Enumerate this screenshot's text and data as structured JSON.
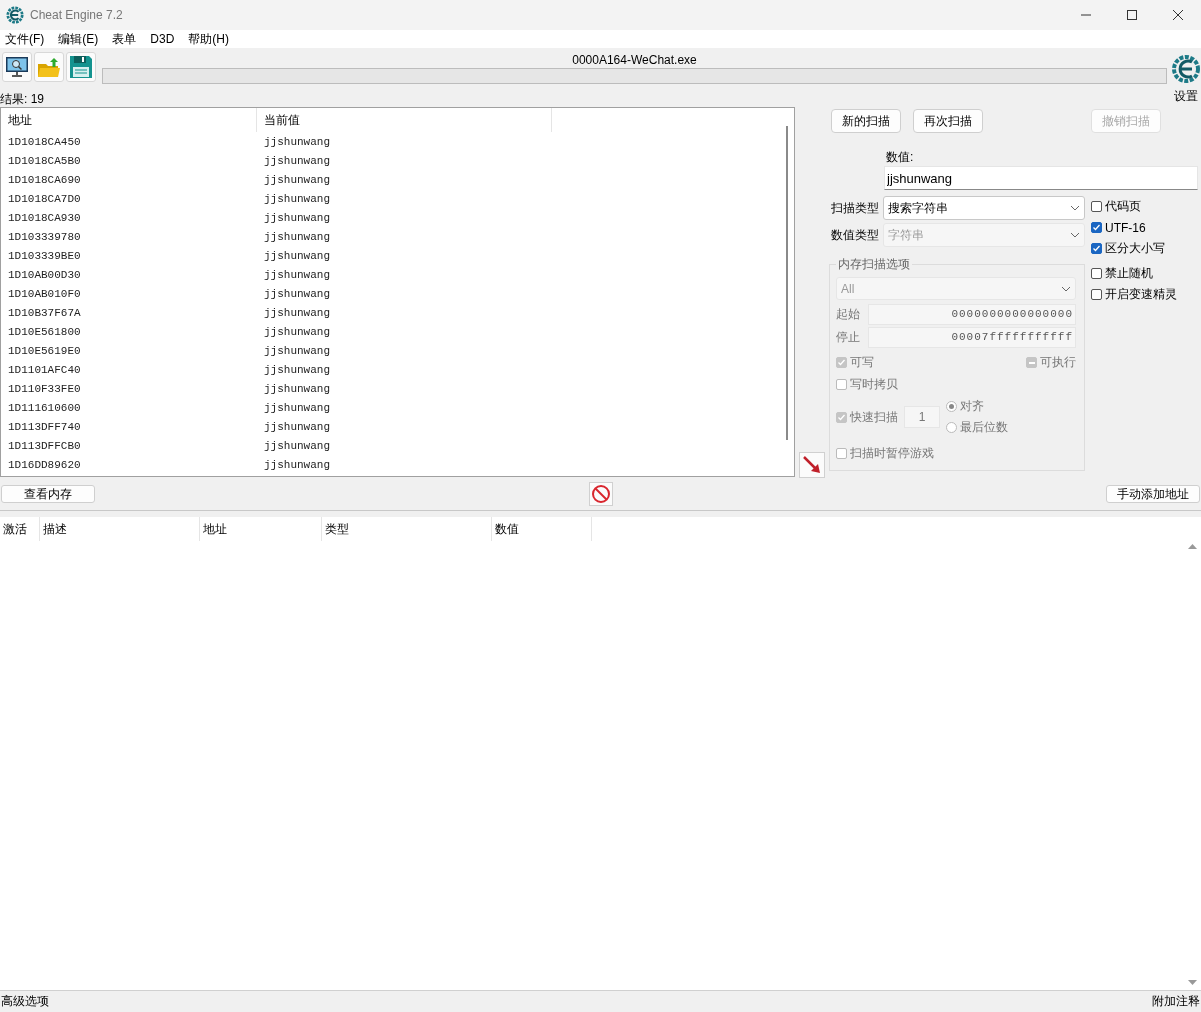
{
  "window": {
    "title": "Cheat Engine 7.2"
  },
  "menu": [
    "文件(F)",
    "编辑(E)",
    "表单",
    "D3D",
    "帮助(H)"
  ],
  "process_title": "0000A164-WeChat.exe",
  "progress": {
    "level": 0
  },
  "settings_label": "设置",
  "results_count": "结果: 19",
  "results": {
    "columns": [
      "地址",
      "当前值"
    ],
    "rows": [
      {
        "address": "1D1018CA450",
        "value": "jjshunwang"
      },
      {
        "address": "1D1018CA5B0",
        "value": "jjshunwang"
      },
      {
        "address": "1D1018CA690",
        "value": "jjshunwang"
      },
      {
        "address": "1D1018CA7D0",
        "value": "jjshunwang"
      },
      {
        "address": "1D1018CA930",
        "value": "jjshunwang"
      },
      {
        "address": "1D103339780",
        "value": "jjshunwang"
      },
      {
        "address": "1D103339BE0",
        "value": "jjshunwang"
      },
      {
        "address": "1D10AB00D30",
        "value": "jjshunwang"
      },
      {
        "address": "1D10AB010F0",
        "value": "jjshunwang"
      },
      {
        "address": "1D10B37F67A",
        "value": "jjshunwang"
      },
      {
        "address": "1D10E561800",
        "value": "jjshunwang"
      },
      {
        "address": "1D10E5619E0",
        "value": "jjshunwang"
      },
      {
        "address": "1D1101AFC40",
        "value": "jjshunwang"
      },
      {
        "address": "1D110F33FE0",
        "value": "jjshunwang"
      },
      {
        "address": "1D111610600",
        "value": "jjshunwang"
      },
      {
        "address": "1D113DFF740",
        "value": "jjshunwang"
      },
      {
        "address": "1D113DFFCB0",
        "value": "jjshunwang"
      },
      {
        "address": "1D16DD89620",
        "value": "jjshunwang"
      }
    ]
  },
  "scan_buttons": [
    {
      "label": "新的扫描",
      "disabled": false
    },
    {
      "label": "再次扫描",
      "disabled": false
    },
    {
      "label": "撤销扫描",
      "disabled": true
    }
  ],
  "value": {
    "label": "数值:",
    "value": "jjshunwang"
  },
  "scan_type": {
    "label": "扫描类型",
    "value": "搜索字符串",
    "disabled": false
  },
  "value_type": {
    "label": "数值类型",
    "value": "字符串",
    "disabled": true
  },
  "string_options": [
    {
      "label": "代码页",
      "checked": false
    },
    {
      "label": "UTF-16",
      "checked": true
    },
    {
      "label": "区分大小写",
      "checked": true
    }
  ],
  "extra_options": [
    {
      "label": "禁止随机",
      "checked": false
    },
    {
      "label": "开启变速精灵",
      "checked": false
    }
  ],
  "memory_options": {
    "title": "内存扫描选项",
    "disabled": true,
    "region": "All",
    "start": {
      "label": "起始",
      "value": "0000000000000000"
    },
    "stop": {
      "label": "停止",
      "value": "00007fffffffffff"
    },
    "writable": {
      "label": "可写",
      "checked": true
    },
    "executable": {
      "label": "可执行",
      "indeterminate": true
    },
    "copy_on_write": {
      "label": "写时拷贝",
      "checked": false
    },
    "fast_scan": {
      "label": "快速扫描",
      "checked": true,
      "value": "1"
    },
    "alignment": [
      {
        "label": "对齐",
        "selected": true
      },
      {
        "label": "最后位数",
        "selected": false
      }
    ],
    "pause_game": {
      "label": "扫描时暂停游戏",
      "checked": false
    }
  },
  "view_memory": "查看内存",
  "add_address": "手动添加地址",
  "address_table": {
    "columns": [
      "激活",
      "描述",
      "地址",
      "类型",
      "数值"
    ]
  },
  "status_bar": {
    "left": "高级选项",
    "right": "附加注释"
  }
}
